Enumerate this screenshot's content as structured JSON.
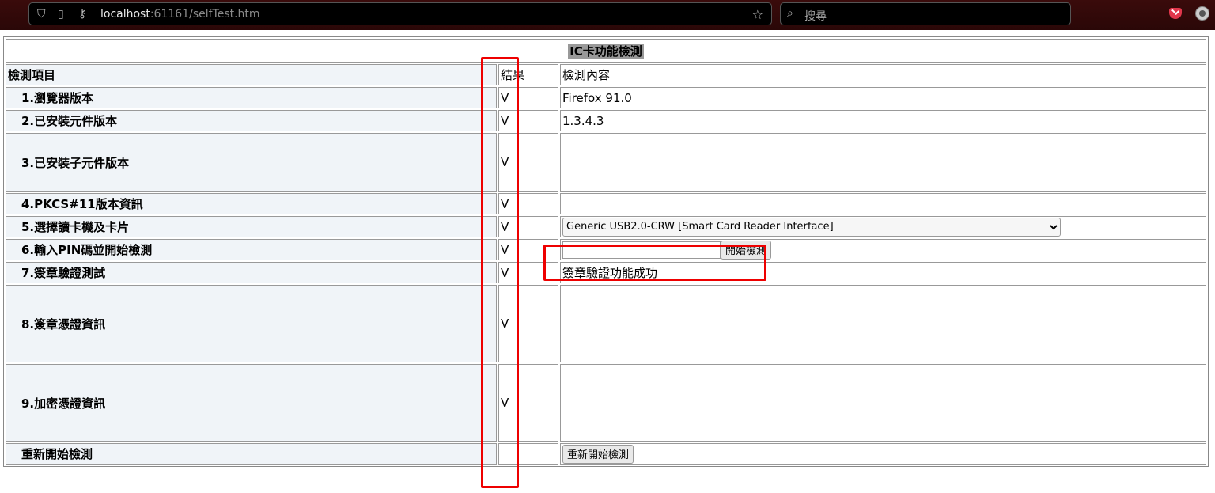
{
  "browser": {
    "url_host": "localhost",
    "url_rest": ":61161/selfTest.htm",
    "search_placeholder": "搜尋"
  },
  "table": {
    "title": "IC卡功能檢測",
    "header": {
      "item": "檢測項目",
      "result": "結果",
      "content": "檢測內容"
    },
    "rows": [
      {
        "item": "1.瀏覽器版本",
        "result": "V",
        "content": "Firefox  91.0"
      },
      {
        "item": "2.已安裝元件版本",
        "result": "V",
        "content": "1.3.4.3"
      },
      {
        "item": "3.已安裝子元件版本",
        "result": "V",
        "content": ""
      },
      {
        "item": "4.PKCS#11版本資訊",
        "result": "V",
        "content": ""
      },
      {
        "item": "5.選擇讀卡機及卡片",
        "result": "V",
        "select_value": "Generic USB2.0-CRW [Smart Card Reader Interface]"
      },
      {
        "item": "6.輸入PIN碼並開始檢測",
        "result": "V",
        "pin_value": "",
        "button": "開始檢測"
      },
      {
        "item": "7.簽章驗證測試",
        "result": "V",
        "content": "簽章驗證功能成功"
      },
      {
        "item": "8.簽章憑證資訊",
        "result": "V",
        "content": ""
      },
      {
        "item": "9.加密憑證資訊",
        "result": "V",
        "content": ""
      },
      {
        "item": "重新開始檢測",
        "result": "",
        "button": "重新開始檢測"
      }
    ]
  },
  "colors": {
    "annotation": "#e00000",
    "label_bg": "#f0f4f8",
    "title_highlight": "#999999"
  }
}
